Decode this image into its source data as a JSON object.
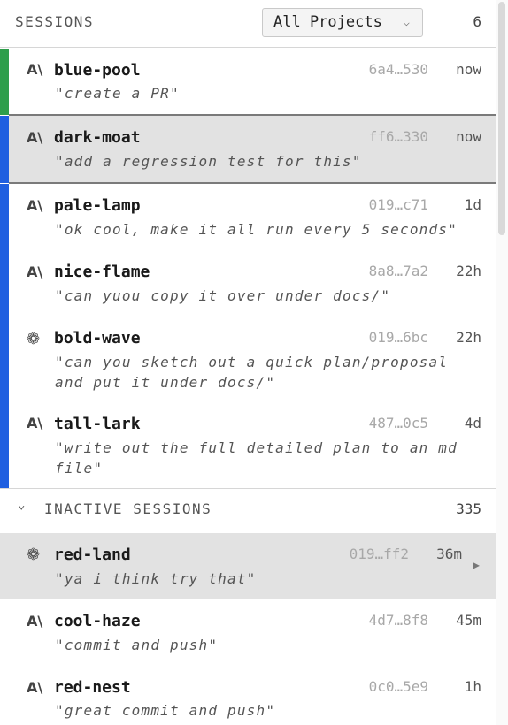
{
  "header": {
    "title": "SESSIONS",
    "project_filter": "All Projects",
    "count": "6"
  },
  "colors": {
    "green": "#2e9e4b",
    "blue": "#1f5fe0",
    "selected_bg": "#e2e2e2"
  },
  "active_sessions": [
    {
      "name": "blue-pool",
      "icon": "anthropic-icon",
      "hash": "6a4…530",
      "age": "now",
      "message": "\"create a PR\""
    },
    {
      "name": "dark-moat",
      "icon": "anthropic-icon",
      "hash": "ff6…330",
      "age": "now",
      "message": "\"add a regression test for this\""
    },
    {
      "name": "pale-lamp",
      "icon": "anthropic-icon",
      "hash": "019…c71",
      "age": "1d",
      "message": "\"ok cool, make it all run every 5 seconds\""
    },
    {
      "name": "nice-flame",
      "icon": "anthropic-icon",
      "hash": "8a8…7a2",
      "age": "22h",
      "message": "\"can yuou copy it over under docs/\""
    },
    {
      "name": "bold-wave",
      "icon": "openai-icon",
      "hash": "019…6bc",
      "age": "22h",
      "message": "\"can you sketch out a quick plan/proposal and put it under docs/\""
    },
    {
      "name": "tall-lark",
      "icon": "anthropic-icon",
      "hash": "487…0c5",
      "age": "4d",
      "message": "\"write out the full detailed plan to an md file\""
    }
  ],
  "inactive": {
    "label": "INACTIVE SESSIONS",
    "count": "335"
  },
  "inactive_sessions": [
    {
      "name": "red-land",
      "icon": "openai-icon",
      "hash": "019…ff2",
      "age": "36m",
      "message": "\"ya i think try that\""
    },
    {
      "name": "cool-haze",
      "icon": "anthropic-icon",
      "hash": "4d7…8f8",
      "age": "45m",
      "message": "\"commit and push\""
    },
    {
      "name": "red-nest",
      "icon": "anthropic-icon",
      "hash": "0c0…5e9",
      "age": "1h",
      "message": "\"great commit and push\""
    }
  ]
}
